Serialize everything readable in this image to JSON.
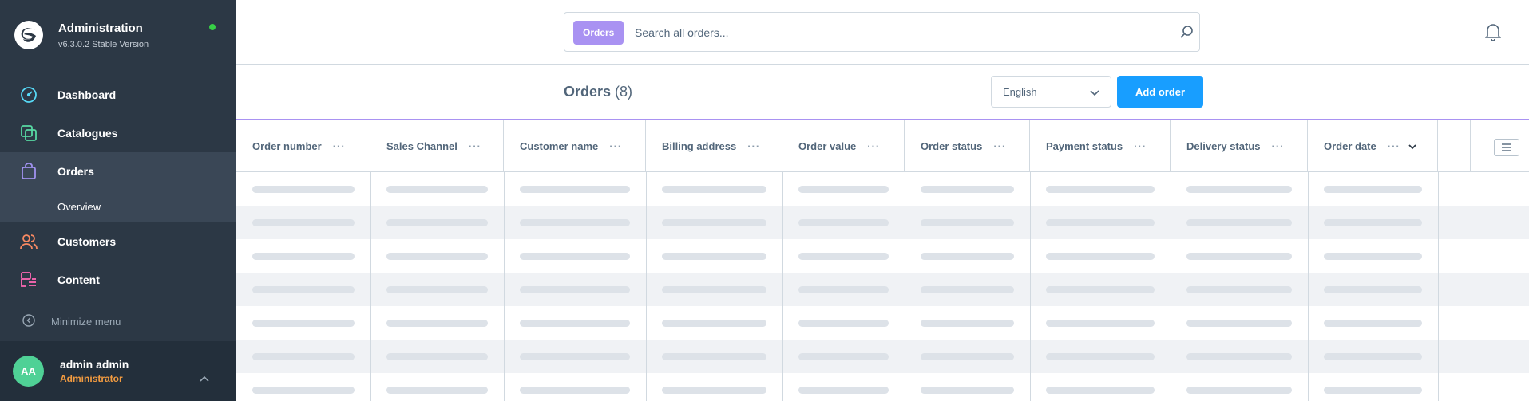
{
  "app": {
    "title": "Administration",
    "version": "v6.3.0.2 Stable Version",
    "status_color": "#37d046"
  },
  "sidebar": {
    "items": [
      {
        "label": "Dashboard",
        "icon": "dashboard-gauge-icon",
        "color": "#57d9f6"
      },
      {
        "label": "Catalogues",
        "icon": "catalogue-icon",
        "color": "#57d9a3"
      },
      {
        "label": "Orders",
        "icon": "shopping-bag-icon",
        "color": "#a092f0"
      },
      {
        "label": "Customers",
        "icon": "users-icon",
        "color": "#f88962"
      },
      {
        "label": "Content",
        "icon": "content-list-icon",
        "color": "#ff68b4"
      }
    ],
    "active_sub": "Overview",
    "minimize_label": "Minimize menu"
  },
  "user": {
    "initials": "AA",
    "name": "admin admin",
    "role": "Administrator"
  },
  "search": {
    "tag": "Orders",
    "placeholder": "Search all orders..."
  },
  "page": {
    "title": "Orders",
    "count": "(8)",
    "language": "English",
    "add_button": "Add order"
  },
  "table": {
    "columns": [
      "Order number",
      "Sales Channel",
      "Customer name",
      "Billing address",
      "Order value",
      "Order status",
      "Payment status",
      "Delivery status",
      "Order date"
    ],
    "loading_rows": 7
  },
  "colors": {
    "sidebar_bg": "#2c3845",
    "accent": "#189eff",
    "orders_purple": "#a992f2",
    "role_orange": "#f29b40",
    "avatar_green": "#4fd196"
  }
}
